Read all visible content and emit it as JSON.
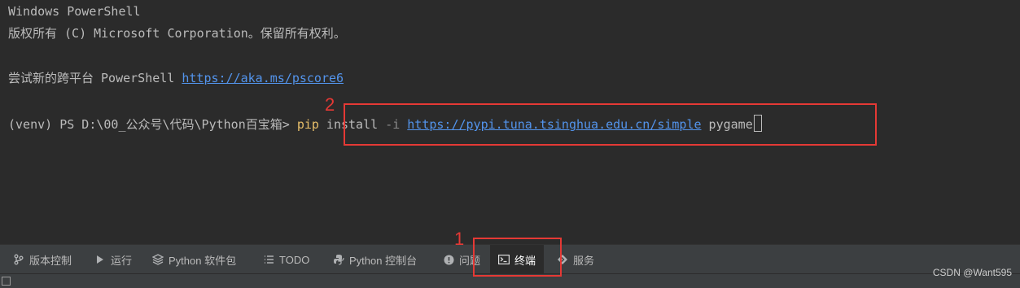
{
  "terminal": {
    "line1": "Windows PowerShell",
    "line2": "版权所有 (C) Microsoft Corporation。保留所有权利。",
    "line3_prefix": "尝试新的跨平台 PowerShell ",
    "line3_link": "https://aka.ms/pscore6",
    "prompt": "(venv) PS D:\\00_公众号\\代码\\Python百宝箱> ",
    "cmd_pip": "pip",
    "cmd_install": " install ",
    "cmd_flag": "-i",
    "cmd_url": "https://pypi.tuna.tsinghua.edu.cn/simple",
    "cmd_pkg": " pygame"
  },
  "toolbar": {
    "items": [
      {
        "label": "版本控制",
        "icon": "branch-icon"
      },
      {
        "label": "运行",
        "icon": "play-icon"
      },
      {
        "label": "Python 软件包",
        "icon": "layers-icon"
      },
      {
        "label": "TODO",
        "icon": "list-icon"
      },
      {
        "label": "Python 控制台",
        "icon": "python-icon"
      },
      {
        "label": "问题",
        "icon": "warning-icon"
      },
      {
        "label": "终端",
        "icon": "terminal-icon",
        "active": true
      },
      {
        "label": "服务",
        "icon": "services-icon"
      }
    ]
  },
  "annotations": {
    "num1": "1",
    "num2": "2"
  },
  "watermark": "CSDN @Want595",
  "colors": {
    "annotation": "#e53935",
    "link": "#5394ec",
    "background": "#2b2b2b"
  }
}
